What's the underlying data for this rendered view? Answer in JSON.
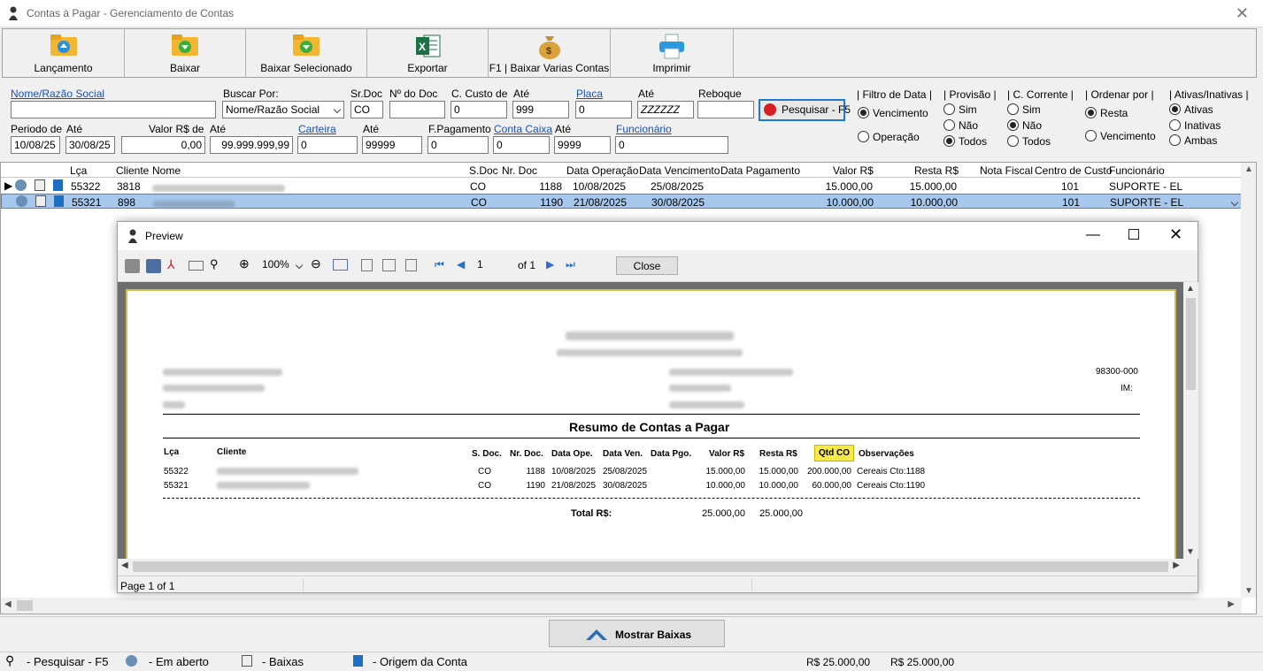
{
  "window": {
    "title": "Contas à Pagar - Gerenciamento de Contas",
    "close": "✕"
  },
  "toolbar": {
    "lancamento": "Lançamento",
    "baixar": "Baixar",
    "baixar_selecionado": "Baixar Selecionado",
    "exportar": "Exportar",
    "baixar_varias": "F1 | Baixar Varias Contas",
    "imprimir": "Imprimir"
  },
  "filters": {
    "nome_label": "Nome/Razão Social",
    "nome_value": "",
    "buscar_por_label": "Buscar Por:",
    "buscar_por_value": "Nome/Razão Social",
    "srdoc_label": "Sr.Doc",
    "srdoc_value": "CO",
    "ndoc_label": "Nº do Doc",
    "ndoc_value": "",
    "ccusto_label": "C. Custo de",
    "ccusto_value": "0",
    "ate1_label": "Até",
    "ate1_value": "999",
    "placa_label": "Placa",
    "placa_value": "0",
    "ate2_label": "Até",
    "ate2_value": "ZZZZZZ",
    "reboque_label": "Reboque",
    "reboque_value": "",
    "pesquisar": "Pesquisar - F5",
    "periodo_label": "Periodo de",
    "periodo_value": "10/08/25",
    "ate3_label": "Até",
    "ate3_value": "30/08/25",
    "valor_label": "Valor R$ de",
    "valor_value": "0,00",
    "ate4_label": "Até",
    "ate4_value": "99.999.999,99",
    "carteira_label": "Carteira",
    "carteira_value": "0",
    "ate5_label": "Até",
    "ate5_value": "99999",
    "fpag_label": "F.Pagamento",
    "fpag_value": "0",
    "contacaixa_label": "Conta Caixa",
    "contacaixa_value": "0",
    "ate6_label": "Até",
    "ate6_value": "9999",
    "funcionario_label": "Funcionário",
    "funcionario_value": "0"
  },
  "options": {
    "filtro_data": {
      "title": "| Filtro de Data |",
      "o1": "Vencimento",
      "o2": "Operação"
    },
    "provisao": {
      "title": "| Provisão |",
      "o1": "Sim",
      "o2": "Não",
      "o3": "Todos"
    },
    "ccorrente": {
      "title": "| C. Corrente |",
      "o1": "Sim",
      "o2": "Não",
      "o3": "Todos"
    },
    "ordenar": {
      "title": "| Ordenar por |",
      "o1": "Resta",
      "o2": "Vencimento"
    },
    "ativas": {
      "title": "| Ativas/Inativas |",
      "o1": "Ativas",
      "o2": "Inativas",
      "o3": "Ambas"
    }
  },
  "grid": {
    "headers": [
      "Lça",
      "Cliente",
      "Nome",
      "S.Doc",
      "Nr. Doc",
      "Data Operação",
      "Data Vencimento",
      "Data Pagamento",
      "Valor R$",
      "Resta R$",
      "Nota Fiscal",
      "Centro de Custo",
      "Funcionário"
    ],
    "rows": [
      {
        "lca": "55322",
        "cliente": "3818",
        "sdoc": "CO",
        "nrdoc": "1188",
        "dop": "10/08/2025",
        "dven": "25/08/2025",
        "dpag": "",
        "valor": "15.000,00",
        "resta": "15.000,00",
        "nf": "",
        "cc": "101",
        "func": "SUPORTE - EL"
      },
      {
        "lca": "55321",
        "cliente": "898",
        "sdoc": "CO",
        "nrdoc": "1190",
        "dop": "21/08/2025",
        "dven": "30/08/2025",
        "dpag": "",
        "valor": "10.000,00",
        "resta": "10.000,00",
        "nf": "",
        "cc": "101",
        "func": "SUPORTE - EL"
      }
    ]
  },
  "preview": {
    "title": "Preview",
    "zoom": "100%",
    "page": "1",
    "of": "of 1",
    "close": "Close",
    "status": "Page 1 of 1",
    "report": {
      "cep": "98300-000",
      "uf": "IM:",
      "title": "Resumo de Contas a Pagar",
      "headers": {
        "lca": "Lça",
        "cliente": "Cliente",
        "sdoc": "S. Doc.",
        "nrdoc": "Nr. Doc.",
        "dope": "Data Ope.",
        "dven": "Data Ven.",
        "dpgo": "Data Pgo.",
        "valor": "Valor R$",
        "resta": "Resta R$",
        "qtd": "Qtd CO",
        "obs": "Observações"
      },
      "rows": [
        {
          "lca": "55322",
          "sdoc": "CO",
          "nrdoc": "1188",
          "dope": "10/08/2025",
          "dven": "25/08/2025",
          "valor": "15.000,00",
          "resta": "15.000,00",
          "qtd": "200.000,00",
          "obs": "Cereais Cto:1188"
        },
        {
          "lca": "55321",
          "sdoc": "CO",
          "nrdoc": "1190",
          "dope": "21/08/2025",
          "dven": "30/08/2025",
          "valor": "10.000,00",
          "resta": "10.000,00",
          "qtd": "60.000,00",
          "obs": "Cereais Cto:1190"
        }
      ],
      "total_label": "Total R$:",
      "total_valor": "25.000,00",
      "total_resta": "25.000,00"
    }
  },
  "footer": {
    "mostrar_baixas": "Mostrar Baixas"
  },
  "statusbar": {
    "pesquisar": "- Pesquisar - F5",
    "aberto": "- Em aberto",
    "baixas": "- Baixas",
    "origem": "- Origem da Conta",
    "total1": "R$ 25.000,00",
    "total2": "R$ 25.000,00"
  },
  "colors": {
    "accent": "#1f78d1",
    "selected_row": "#a7c8ec",
    "link": "#1a4fb8",
    "highlight": "#f6e94a"
  }
}
